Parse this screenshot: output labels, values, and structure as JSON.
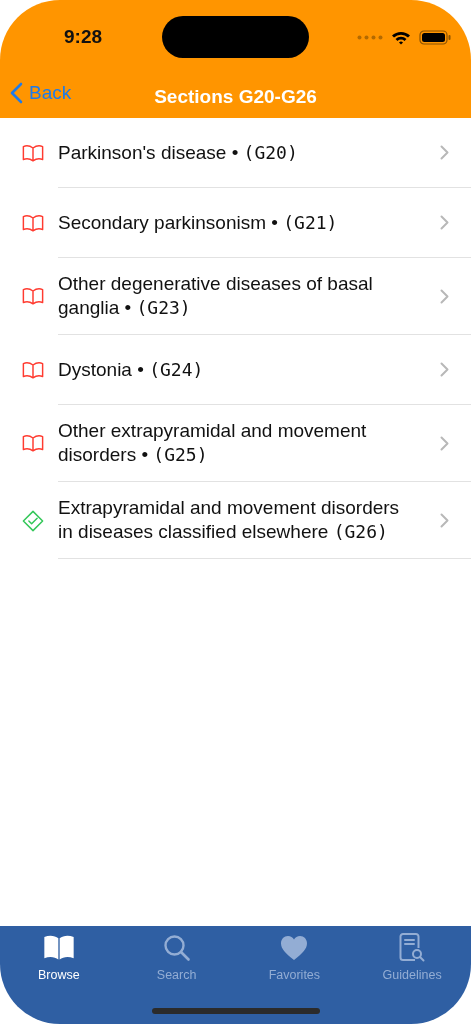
{
  "status_bar": {
    "time": "9:28"
  },
  "nav": {
    "back": "Back",
    "title": "Sections G20-G26"
  },
  "items": [
    {
      "kind": "book",
      "title": "Parkinson's disease •",
      "code": "(G20)"
    },
    {
      "kind": "book",
      "title": "Secondary parkinsonism •",
      "code": "(G21)"
    },
    {
      "kind": "book",
      "title": "Other degenerative diseases of basal ganglia •",
      "code": "(G23)"
    },
    {
      "kind": "book",
      "title": "Dystonia •",
      "code": "(G24)"
    },
    {
      "kind": "book",
      "title": "Other extrapyramidal and movement disorders •",
      "code": "(G25)"
    },
    {
      "kind": "check",
      "title": "Extrapyramidal and movement disorders in diseases classified elsewhere",
      "code": "(G26)"
    }
  ],
  "tabs": [
    {
      "kind": "browse",
      "label": "Browse",
      "selected": true
    },
    {
      "kind": "search",
      "label": "Search",
      "selected": false
    },
    {
      "kind": "favorites",
      "label": "Favorites",
      "selected": false
    },
    {
      "kind": "guidelines",
      "label": "Guidelines",
      "selected": false
    }
  ]
}
